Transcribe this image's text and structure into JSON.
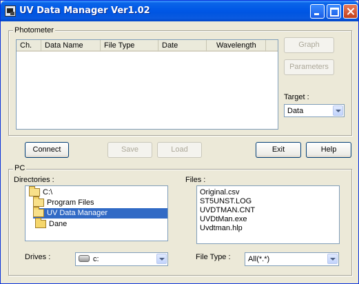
{
  "window": {
    "title": "UV Data Manager Ver1.02"
  },
  "photometer": {
    "group_label": "Photometer",
    "columns": [
      "Ch.",
      "Data Name",
      "File Type",
      "Date",
      "Wavelength"
    ],
    "graph_label": "Graph",
    "parameters_label": "Parameters",
    "target_label": "Target :",
    "target_value": "Data"
  },
  "actions": {
    "connect": "Connect",
    "save": "Save",
    "load": "Load",
    "exit": "Exit",
    "help": "Help"
  },
  "pc": {
    "group_label": "PC",
    "directories_label": "Directories :",
    "directories": [
      "C:\\",
      "Program Files",
      "UV Data Manager",
      "Dane"
    ],
    "selected_directory": "UV Data Manager",
    "files_label": "Files :",
    "files": [
      "Original.csv",
      "ST5UNST.LOG",
      "UVDTMAN.CNT",
      "UVDtMan.exe",
      "Uvdtman.hlp"
    ],
    "drives_label": "Drives :",
    "drive_value": "c:",
    "file_type_label": "File Type :",
    "file_type_value": "All(*.*)"
  },
  "colors": {
    "selection": "#316ac5",
    "title_bar": "#0058e6",
    "window_bg": "#ece9d8"
  }
}
